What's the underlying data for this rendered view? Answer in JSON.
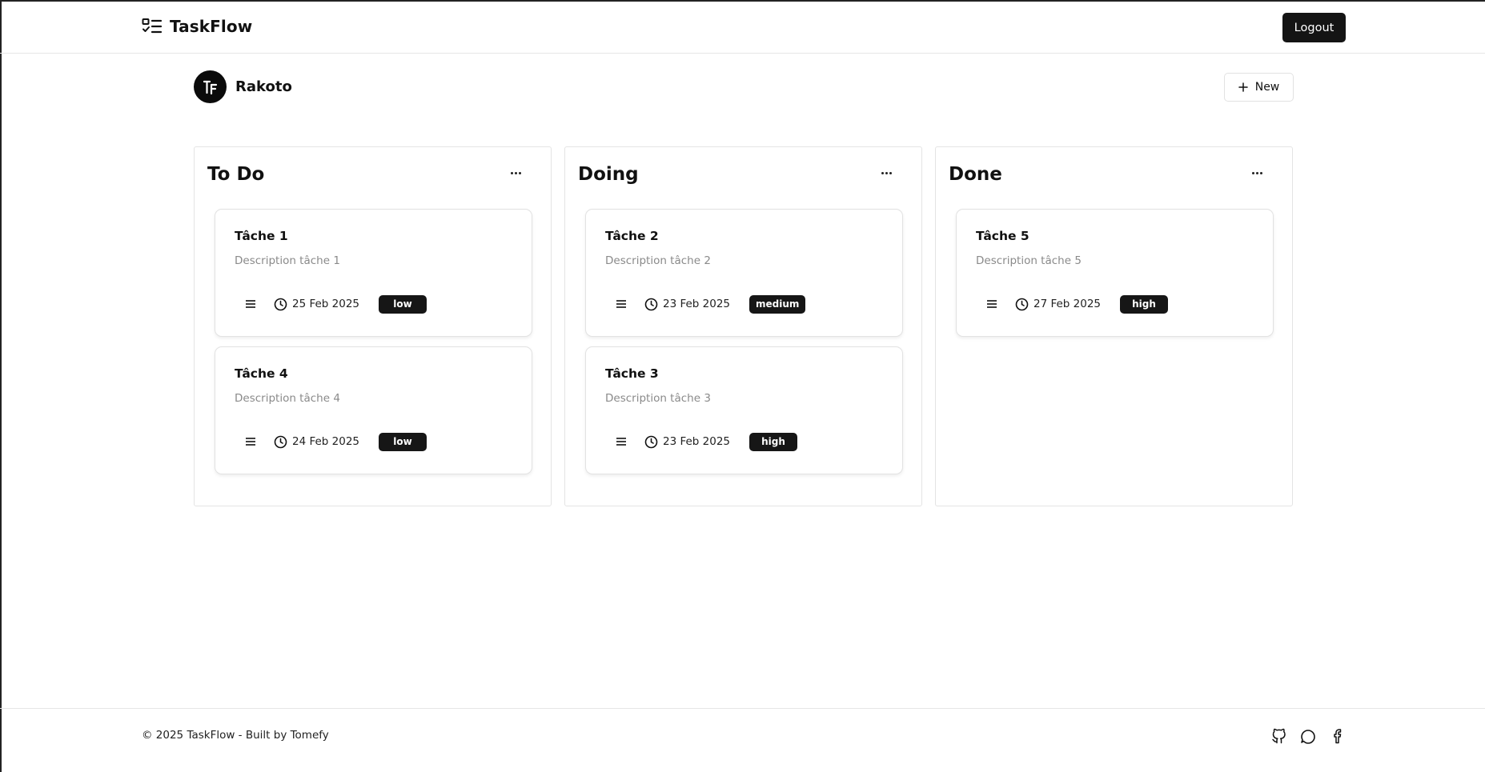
{
  "header": {
    "brand": "TaskFlow",
    "logout_label": "Logout"
  },
  "user": {
    "name": "Rakoto",
    "new_label": "New"
  },
  "columns": [
    {
      "title": "To Do",
      "cards": [
        {
          "title": "Tâche 1",
          "description": "Description tâche 1",
          "date": "25 Feb 2025",
          "priority": "low"
        },
        {
          "title": "Tâche 4",
          "description": "Description tâche 4",
          "date": "24 Feb 2025",
          "priority": "low"
        }
      ]
    },
    {
      "title": "Doing",
      "cards": [
        {
          "title": "Tâche 2",
          "description": "Description tâche 2",
          "date": "23 Feb 2025",
          "priority": "medium"
        },
        {
          "title": "Tâche 3",
          "description": "Description tâche 3",
          "date": "23 Feb 2025",
          "priority": "high"
        }
      ]
    },
    {
      "title": "Done",
      "cards": [
        {
          "title": "Tâche 5",
          "description": "Description tâche 5",
          "date": "27 Feb 2025",
          "priority": "high"
        }
      ]
    }
  ],
  "footer": {
    "copyright": "© 2025 TaskFlow - Built by Tomefy",
    "social_icons": [
      "github-icon",
      "chat-icon",
      "facebook-icon"
    ]
  },
  "colors": {
    "primary": "#141414",
    "badge": "#161616",
    "muted_text": "#8a8a8a",
    "border": "#e4e4e4"
  }
}
